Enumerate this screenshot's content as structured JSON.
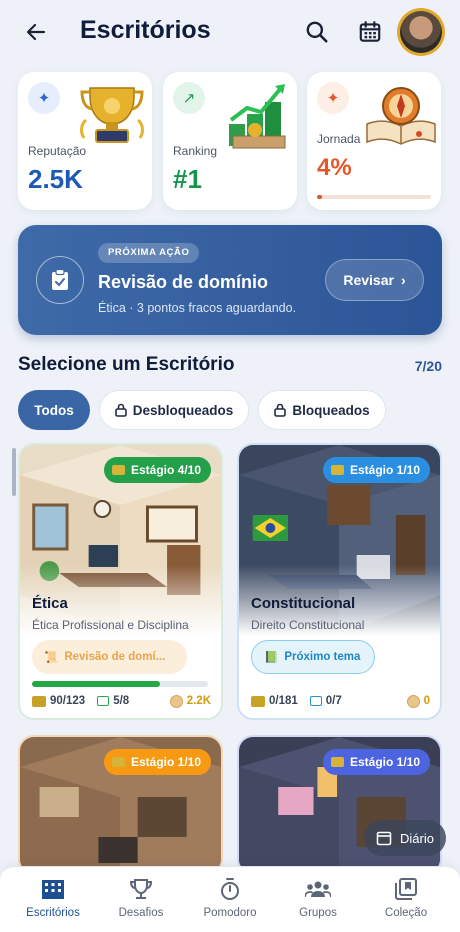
{
  "header": {
    "title": "Escritórios"
  },
  "stats": [
    {
      "label": "Reputação",
      "value": "2.5K",
      "color": "#1d59b5",
      "icon": "sparkle-icon"
    },
    {
      "label": "Ranking",
      "value": "#1",
      "color": "#16944a",
      "icon": "trend-up-icon"
    },
    {
      "label": "Jornada",
      "value": "4%",
      "color": "#e4572a",
      "icon": "sparkle-icon",
      "progress": 0.04
    }
  ],
  "next_action": {
    "tag": "PRÓXIMA AÇÃO",
    "title": "Revisão de domínio",
    "subtitle": "Ética · 3 pontos fracos aguardando.",
    "button": "Revisar"
  },
  "section": {
    "title": "Selecione um Escritório",
    "count": "7/20"
  },
  "filters": [
    {
      "label": "Todos",
      "active": true
    },
    {
      "label": "Desbloqueados",
      "active": false
    },
    {
      "label": "Bloqueados",
      "active": false
    }
  ],
  "offices": [
    {
      "stage": "Estágio 4/10",
      "stage_color": "#24a04a",
      "name": "Ética",
      "subtitle": "Ética Profissional e Disciplina",
      "action": "Revisão de domí...",
      "progress": 0.73,
      "cash": "90/123",
      "done": "5/8",
      "coins": "2.2K"
    },
    {
      "stage": "Estágio 1/10",
      "stage_color": "#2a8fe0",
      "name": "Constitucional",
      "subtitle": "Direito Constitucional",
      "action": "Próximo tema",
      "progress": 0,
      "cash": "0/181",
      "done": "0/7",
      "coins": "0"
    },
    {
      "stage": "Estágio 1/10",
      "stage_color": "#f59a12"
    },
    {
      "stage": "Estágio 1/10",
      "stage_color": "#4d64e0"
    }
  ],
  "diary": "Diário",
  "nav": [
    {
      "label": "Escritórios",
      "icon": "building-icon",
      "active": true
    },
    {
      "label": "Desafios",
      "icon": "trophy-icon"
    },
    {
      "label": "Pomodoro",
      "icon": "stopwatch-icon"
    },
    {
      "label": "Grupos",
      "icon": "group-icon"
    },
    {
      "label": "Coleção",
      "icon": "collection-icon"
    }
  ]
}
